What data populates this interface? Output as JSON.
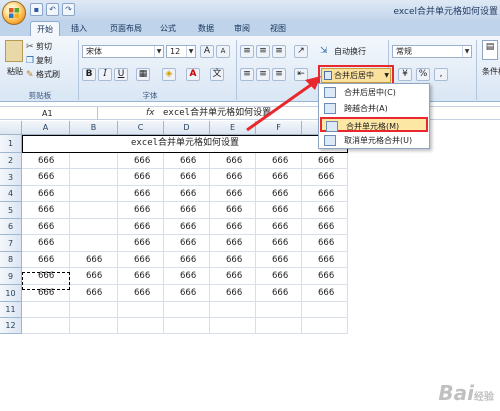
{
  "window": {
    "title": "excel合并单元格如何设置"
  },
  "qat": {
    "save_icon": "save-icon",
    "undo_icon": "undo-icon",
    "redo_icon": "redo-icon"
  },
  "tabs": [
    "开始",
    "插入",
    "页面布局",
    "公式",
    "数据",
    "审阅",
    "视图"
  ],
  "ribbon": {
    "paste_label": "粘贴",
    "cut_label": "剪切",
    "copy_label": "复制",
    "format_painter_label": "格式刷",
    "clipboard_group": "剪贴板",
    "font_name": "宋体",
    "font_size": "12",
    "font_group": "字体",
    "bold": "B",
    "italic": "I",
    "underline": "U",
    "wrap_text_label": "自动换行",
    "merge_center_label": "合并后居中",
    "number_format": "常规",
    "percent": "%",
    "comma": ",",
    "conditional_format_label": "条件格"
  },
  "formula_bar": {
    "cell_ref": "A1",
    "fx": "fx",
    "formula": "excel合并单元格如何设置"
  },
  "sheet": {
    "columns": [
      "A",
      "B",
      "C",
      "D",
      "E",
      "F",
      "G"
    ],
    "rows": [
      "1",
      "2",
      "3",
      "4",
      "5",
      "6",
      "7",
      "8",
      "9",
      "10",
      "11",
      "12"
    ],
    "merged_title": "excel合并单元格如何设置",
    "cells": [
      [
        "666",
        "",
        "666",
        "666",
        "666",
        "666",
        "666"
      ],
      [
        "666",
        "",
        "666",
        "666",
        "666",
        "666",
        "666"
      ],
      [
        "666",
        "",
        "666",
        "666",
        "666",
        "666",
        "666"
      ],
      [
        "666",
        "",
        "666",
        "666",
        "666",
        "666",
        "666"
      ],
      [
        "666",
        "",
        "666",
        "666",
        "666",
        "666",
        "666"
      ],
      [
        "666",
        "",
        "666",
        "666",
        "666",
        "666",
        "666"
      ],
      [
        "666",
        "666",
        "666",
        "666",
        "666",
        "666",
        "666"
      ],
      [
        "666",
        "666",
        "666",
        "666",
        "666",
        "666",
        "666"
      ],
      [
        "666",
        "666",
        "666",
        "666",
        "666",
        "666",
        "666"
      ]
    ]
  },
  "dropdown": {
    "items": [
      "合并后居中(C)",
      "跨越合并(A)",
      "合并单元格(M)",
      "取消单元格合并(U)"
    ],
    "highlighted_index": 2
  },
  "watermark": {
    "text": "Bai",
    "suffix": "经验"
  }
}
